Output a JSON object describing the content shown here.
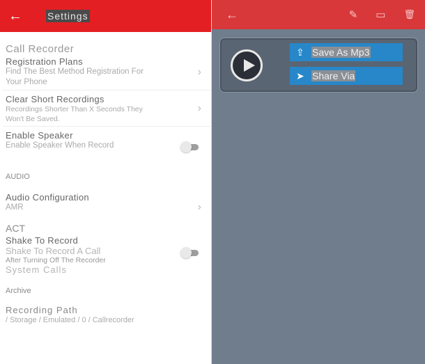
{
  "settings": {
    "title": "Settings",
    "back_icon": "arrow-left-icon",
    "groups": {
      "call_recorder": "Call Recorder",
      "audio": "AUDIO",
      "act": "ACT",
      "archive": "Archive"
    },
    "items": {
      "registration_plans": {
        "title": "Registration Plans",
        "subtitle": "Find The Best Method Registration For Your Phone"
      },
      "clear_short": {
        "title": "Clear Short Recordings",
        "subtitle": "Recordings Shorter Than X Seconds They Won't Be Saved."
      },
      "enable_speaker": {
        "title": "Enable Speaker",
        "subtitle": "Enable Speaker When Record",
        "enabled": false
      },
      "audio_config": {
        "title": "Audio Configuration",
        "subtitle": "AMR"
      },
      "shake_to_record": {
        "title": "Shake To Record",
        "subtitle1": "Shake To Record A Call",
        "subtitle2": "After Turning Off The Recorder",
        "subtitle3": "System Calls",
        "enabled": false
      },
      "recording_path": {
        "title": "Recording Path",
        "subtitle": "/ Storage / Emulated / 0 / Callrecorder"
      }
    },
    "chevron": "›"
  },
  "player": {
    "icons": {
      "back": "←",
      "edit": "✎",
      "devices": "▭",
      "delete": "🗑"
    },
    "save_label": "Save As Mp3",
    "share_label": "Share Via",
    "save_icon": "⇪",
    "share_icon": "➤"
  },
  "colors": {
    "appbar_left": "#e41f23",
    "appbar_right": "#d9383a",
    "panel": "#6f7d8c",
    "button": "#2787c8"
  }
}
